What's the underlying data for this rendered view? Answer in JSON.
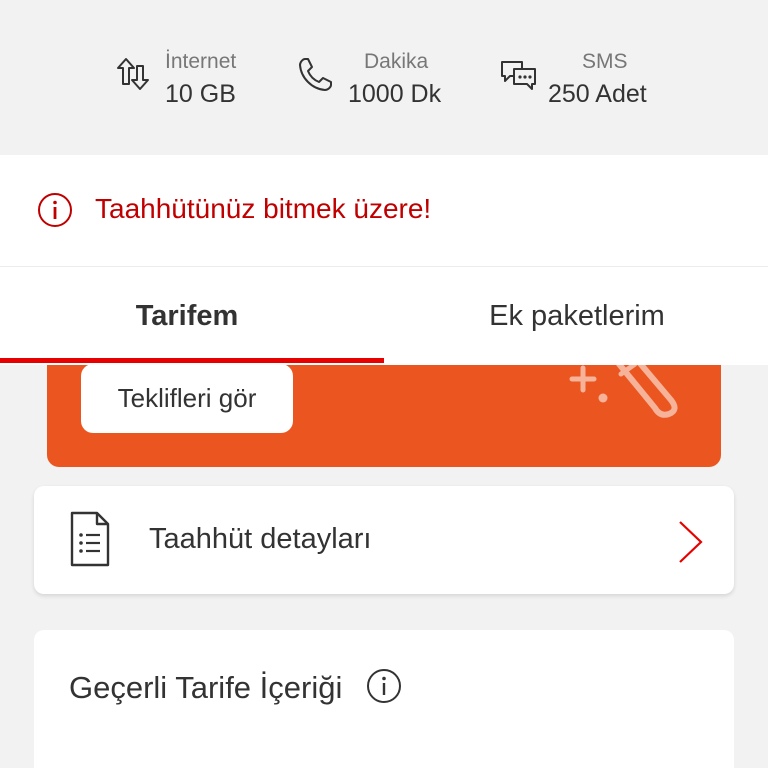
{
  "usage": {
    "internet": {
      "label": "İnternet",
      "value": "10 GB",
      "icon": "data-transfer-icon"
    },
    "minutes": {
      "label": "Dakika",
      "value": "1000 Dk",
      "icon": "phone-icon"
    },
    "sms": {
      "label": "SMS",
      "value": "250 Adet",
      "icon": "chat-bubbles-icon"
    }
  },
  "warning": {
    "text": "Taahhütünüz bitmek üzere!",
    "icon": "info-circle-icon",
    "color": "#c00000"
  },
  "tabs": [
    {
      "label": "Tarifem",
      "active": true
    },
    {
      "label": "Ek paketlerim",
      "active": false
    }
  ],
  "promo": {
    "button_label": "Teklifleri gör",
    "background": "#eb5620",
    "art_icon": "magic-wand-icon"
  },
  "details": {
    "label": "Taahhüt detayları",
    "icon": "document-list-icon",
    "chevron": "chevron-right-icon"
  },
  "tariff": {
    "title": "Geçerli Tarife İçeriği",
    "info_icon": "info-circle-icon"
  },
  "colors": {
    "accent": "#e60000",
    "orange": "#eb5620",
    "background": "#f2f2f2"
  }
}
